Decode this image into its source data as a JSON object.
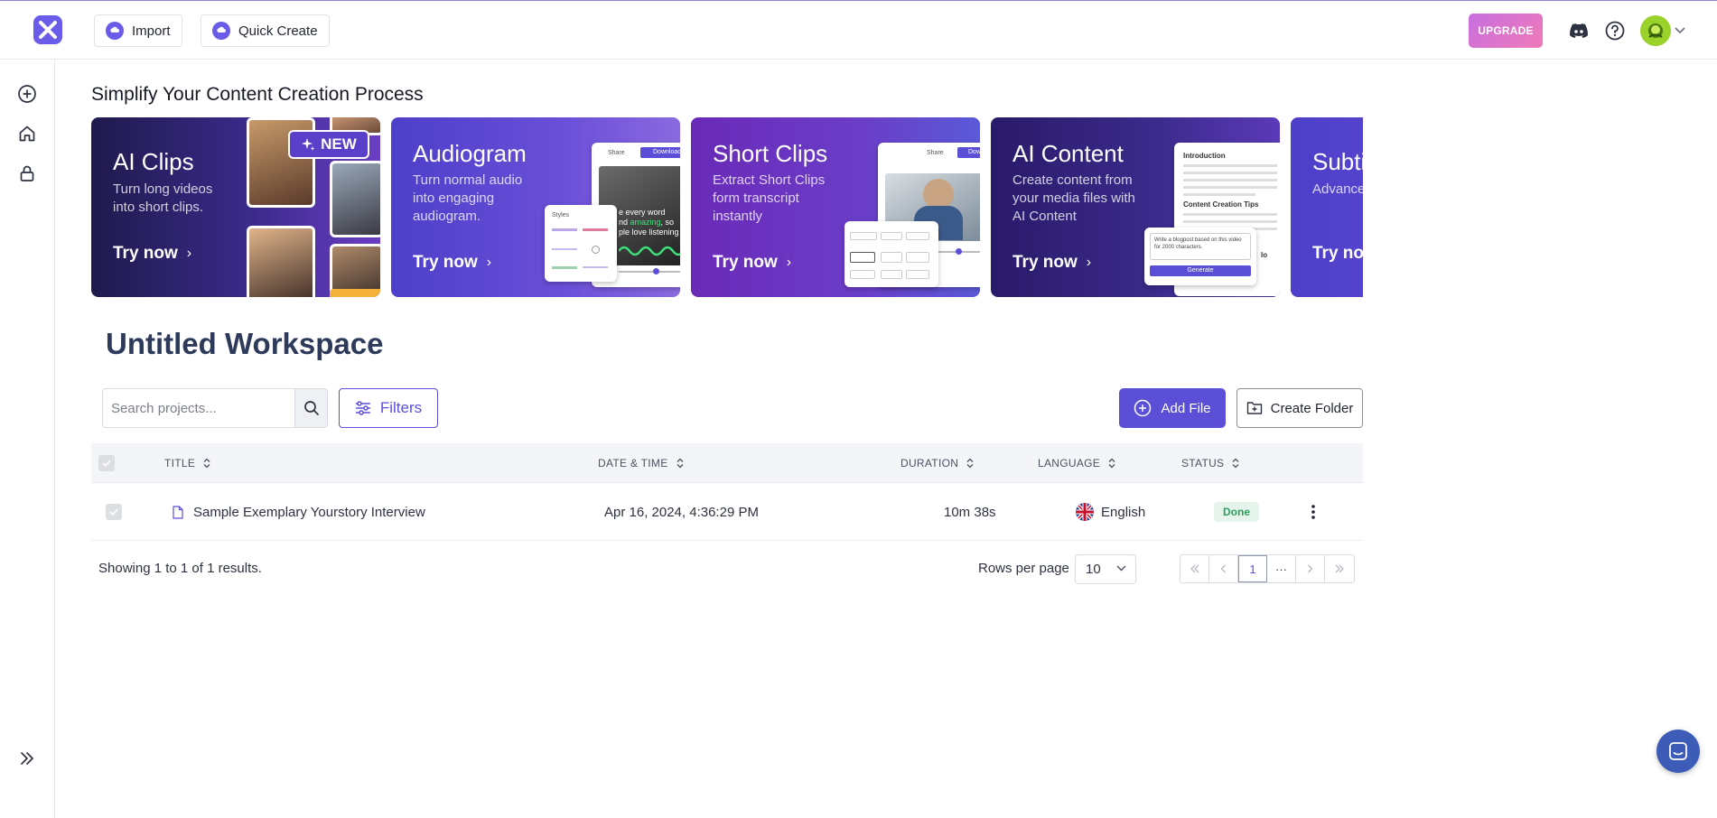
{
  "topbar": {
    "import_label": "Import",
    "quick_create_label": "Quick Create",
    "upgrade_label": "UPGRADE"
  },
  "main": {
    "heading": "Simplify Your Content Creation Process",
    "cards": [
      {
        "title": "AI Clips",
        "desc": "Turn long videos into short clips.",
        "cta": "Try now",
        "badge": "NEW"
      },
      {
        "title": "Audiogram",
        "desc": "Turn normal audio into engaging audiogram.",
        "cta": "Try now"
      },
      {
        "title": "Short Clips",
        "desc": "Extract Short Clips form transcript instantly",
        "cta": "Try now"
      },
      {
        "title": "AI Content",
        "desc": "Create content from your media files with AI Content",
        "cta": "Try now"
      },
      {
        "title": "Subti",
        "desc": "Advance for pro u",
        "cta": "Try no"
      }
    ],
    "mock_text": {
      "share": "Share",
      "download": "Download",
      "styles": "Styles",
      "caption_line1": "e every word",
      "caption_line2_a": "nd ",
      "caption_line2_b": "amazing",
      "caption_line2_c": ", so",
      "caption_line3": "ple love listening",
      "intro": "Introduction",
      "tips": "Content Creation Tips",
      "prompt": "Write a blogpost based on this video for 2000 characters.",
      "generate": "Generate",
      "lo": "lo"
    },
    "workspace_title": "Untitled Workspace",
    "search_placeholder": "Search projects...",
    "filters_label": "Filters",
    "add_file_label": "Add File",
    "create_folder_label": "Create Folder"
  },
  "table": {
    "headers": {
      "title": "TITLE",
      "date": "DATE & TIME",
      "duration": "DURATION",
      "language": "LANGUAGE",
      "status": "STATUS"
    },
    "rows": [
      {
        "title": "Sample Exemplary Yourstory Interview",
        "date": "Apr 16, 2024, 4:36:29 PM",
        "duration": "10m 38s",
        "language": "English",
        "status": "Done"
      }
    ]
  },
  "footer": {
    "showing": "Showing 1 to 1 of 1 results.",
    "rows_per_page_label": "Rows per page",
    "rows_per_page_value": "10",
    "current_page": "1",
    "ellipsis": "···"
  },
  "colors": {
    "accent": "#5b4fd8",
    "done_bg": "#e6f5ec",
    "done_text": "#2f9e5d"
  }
}
